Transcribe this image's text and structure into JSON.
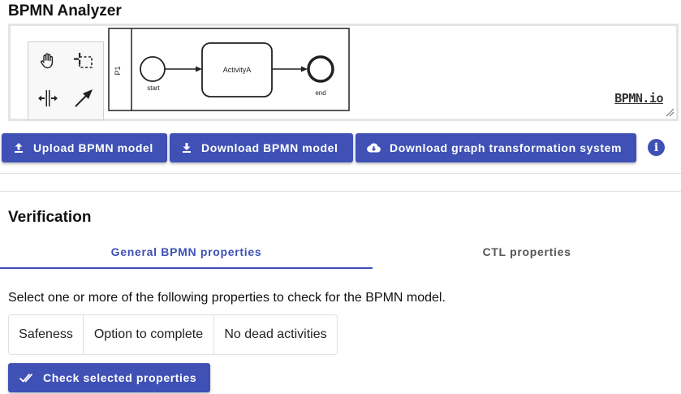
{
  "app": {
    "title": "BPMN Analyzer"
  },
  "modeler": {
    "pool_label": "P1",
    "start_label": "start",
    "task_label": "ActivityA",
    "end_label": "end",
    "logo_text": "BPMN.io",
    "palette_tools": [
      "hand-tool-icon",
      "lasso-tool-icon",
      "space-tool-icon",
      "connect-tool-icon"
    ]
  },
  "toolbar": {
    "upload_label": "Upload BPMN model",
    "download_label": "Download BPMN model",
    "download_gts_label": "Download graph transformation system",
    "info_icon": "info-icon"
  },
  "verification": {
    "title": "Verification",
    "tabs": [
      {
        "label": "General BPMN properties",
        "active": true
      },
      {
        "label": "CTL properties",
        "active": false
      }
    ],
    "instructions": "Select one or more of the following properties to check for the BPMN model.",
    "properties": [
      "Safeness",
      "Option to complete",
      "No dead activities"
    ],
    "check_label": "Check selected properties"
  },
  "colors": {
    "primary": "#3f51b5",
    "divider": "#e0e0e0"
  }
}
